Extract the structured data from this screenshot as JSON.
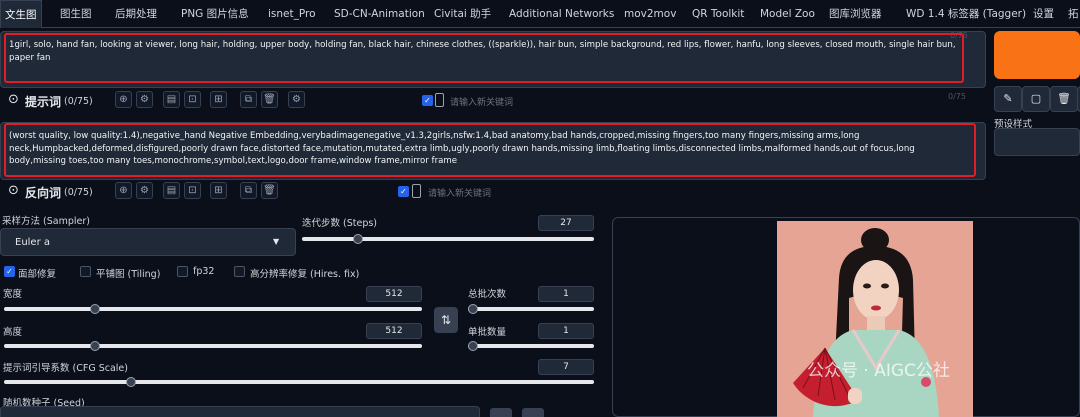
{
  "tabs": [
    {
      "label": "文生图"
    },
    {
      "label": "图生图"
    },
    {
      "label": "后期处理"
    },
    {
      "label": "PNG 图片信息"
    },
    {
      "label": "isnet_Pro"
    },
    {
      "label": "SD-CN-Animation"
    },
    {
      "label": "Civitai 助手"
    },
    {
      "label": "Additional Networks"
    },
    {
      "label": "mov2mov"
    },
    {
      "label": "QR Toolkit"
    },
    {
      "label": "Model Zoo"
    },
    {
      "label": "图库浏览器"
    },
    {
      "label": "WD 1.4 标签器 (Tagger)"
    },
    {
      "label": "设置"
    },
    {
      "label": "拓"
    }
  ],
  "prompt": {
    "text": "1girl, solo, hand fan, looking at viewer, long hair, holding, upper body, holding fan, black hair, chinese clothes, ((sparkle)), hair bun, simple background, red lips, flower, hanfu, long sleeves, closed mouth, single hair bun, paper fan",
    "token_counter": "0/75",
    "label": "提示词",
    "count": "(0/75)",
    "keyword_placeholder": "请输入新关键词"
  },
  "negative": {
    "text": "(worst quality, low quality:1.4),negative_hand Negative Embedding,verybadimagenegative_v1.3,2girls,nsfw:1.4,bad anatomy,bad hands,cropped,missing fingers,too many fingers,missing arms,long neck,Humpbacked,deformed,disfigured,poorly drawn face,distorted face,mutation,mutated,extra limb,ugly,poorly drawn hands,missing limb,floating limbs,disconnected limbs,malformed hands,out of focus,long body,missing toes,too many toes,monochrome,symbol,text,logo,door frame,window frame,mirror frame",
    "token_counter": "0/75",
    "label": "反向词",
    "count": "(0/75)",
    "keyword_placeholder": "请输入新关键词"
  },
  "styles": {
    "label": "预设样式"
  },
  "sampler": {
    "label": "采样方法 (Sampler)",
    "value": "Euler a"
  },
  "steps": {
    "label": "迭代步数 (Steps)",
    "value": "27",
    "fraction": 0.18
  },
  "checkboxes": {
    "face_restore": {
      "label": "面部修复",
      "checked": true
    },
    "tiling": {
      "label": "平铺图 (Tiling)",
      "checked": false
    },
    "fp32": {
      "label": "fp32",
      "checked": false
    },
    "hires": {
      "label": "高分辨率修复 (Hires. fix)",
      "checked": false
    }
  },
  "width": {
    "label": "宽度",
    "value": "512",
    "fraction": 0.21
  },
  "height": {
    "label": "高度",
    "value": "512",
    "fraction": 0.21
  },
  "batch_count": {
    "label": "总批次数",
    "value": "1",
    "fraction": 0.0
  },
  "batch_size": {
    "label": "单批数量",
    "value": "1",
    "fraction": 0.0
  },
  "cfg": {
    "label": "提示词引导系数 (CFG Scale)",
    "value": "7",
    "fraction": 0.21
  },
  "seed": {
    "label": "随机数种子 (Seed)"
  },
  "watermark": {
    "text": "公众号 · AIGC公社"
  },
  "colors": {
    "accent": "#f97316",
    "red_highlight": "#e11d2a",
    "checkbox_blue": "#2563eb",
    "bg": "#0b0f19"
  }
}
